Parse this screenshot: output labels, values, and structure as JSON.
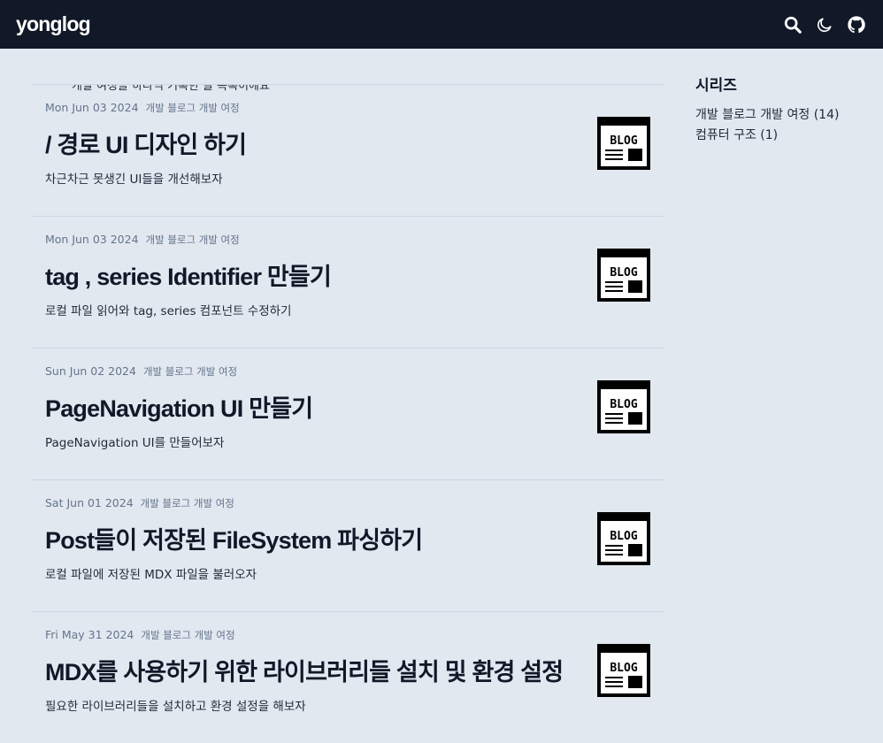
{
  "header": {
    "logo": "yonglog",
    "icons": [
      "search-icon",
      "moon-icon",
      "github-icon"
    ]
  },
  "cut_text": "개발 여정을 하나씩 기록한 글 목록이에요",
  "posts": [
    {
      "date": "Mon Jun 03 2024",
      "series": "개발 블로그 개발 여정",
      "title": "/ 경로 UI 디자인 하기",
      "desc": "차근차근 못생긴 UI들을 개선해보자",
      "thumb": "BLOG"
    },
    {
      "date": "Mon Jun 03 2024",
      "series": "개발 블로그 개발 여정",
      "title": "tag , series Identifier 만들기",
      "desc": "로컬 파일 읽어와 tag, series 컴포넌트 수정하기",
      "thumb": "BLOG"
    },
    {
      "date": "Sun Jun 02 2024",
      "series": "개발 블로그 개발 여정",
      "title": "PageNavigation UI 만들기",
      "desc": "PageNavigation UI를 만들어보자",
      "thumb": "BLOG"
    },
    {
      "date": "Sat Jun 01 2024",
      "series": "개발 블로그 개발 여정",
      "title": "Post들이 저장된 FileSystem 파싱하기",
      "desc": "로컬 파일에 저장된 MDX 파일을 불러오자",
      "thumb": "BLOG"
    },
    {
      "date": "Fri May 31 2024",
      "series": "개발 블로그 개발 여정",
      "title": "MDX를 사용하기 위한 라이브러리들 설치 및 환경 설정",
      "desc": "필요한 라이브러리들을 설치하고 환경 설정을 해보자",
      "thumb": "BLOG"
    }
  ],
  "sidebar": {
    "title": "시리즈",
    "items": [
      "개발 블로그 개발 여정 (14)",
      "컴퓨터 구조 (1)"
    ]
  }
}
